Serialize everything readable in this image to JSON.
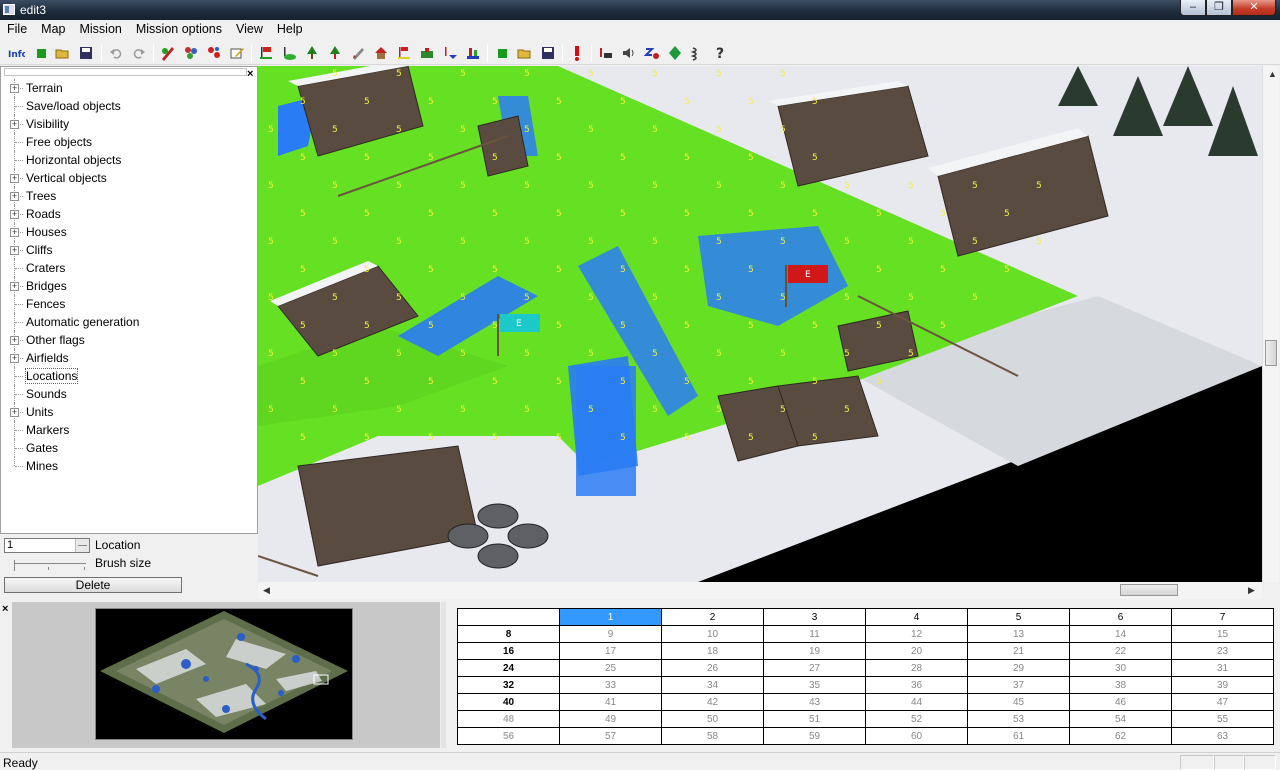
{
  "window": {
    "title": "edit3"
  },
  "menu": [
    "File",
    "Map",
    "Mission",
    "Mission options",
    "View",
    "Help"
  ],
  "toolbar": {
    "info_label": "Info",
    "icons": [
      "info-icon",
      "new-icon",
      "open-icon",
      "save-icon",
      "undo-icon",
      "redo-icon",
      "terrain-paint-icon",
      "objects-icon",
      "objects-red-icon",
      "edit-icon",
      "flag-place-icon",
      "flag-green-icon",
      "tree-icon",
      "tree-red-icon",
      "pencil-icon",
      "house-icon",
      "flag-yellow-icon",
      "unit-icon",
      "marker-icon",
      "airfield-icon",
      "green-square-icon",
      "open-icon",
      "save-icon",
      "alert-icon",
      "sound-icon",
      "speaker-icon",
      "mines-icon",
      "diamond-icon",
      "wave-icon",
      "help-icon"
    ]
  },
  "tree": {
    "items": [
      {
        "label": "Terrain",
        "expandable": true
      },
      {
        "label": "Save/load objects",
        "expandable": false
      },
      {
        "label": "Visibility",
        "expandable": true
      },
      {
        "label": "Free objects",
        "expandable": false
      },
      {
        "label": "Horizontal objects",
        "expandable": false
      },
      {
        "label": "Vertical objects",
        "expandable": true
      },
      {
        "label": "Trees",
        "expandable": true
      },
      {
        "label": "Roads",
        "expandable": true
      },
      {
        "label": "Houses",
        "expandable": true
      },
      {
        "label": "Cliffs",
        "expandable": true
      },
      {
        "label": "Craters",
        "expandable": false
      },
      {
        "label": "Bridges",
        "expandable": true
      },
      {
        "label": "Fences",
        "expandable": false
      },
      {
        "label": "Automatic generation",
        "expandable": false
      },
      {
        "label": "Other flags",
        "expandable": true
      },
      {
        "label": "Airfields",
        "expandable": true
      },
      {
        "label": "Locations",
        "expandable": false,
        "selected": true
      },
      {
        "label": "Sounds",
        "expandable": false
      },
      {
        "label": "Units",
        "expandable": true
      },
      {
        "label": "Markers",
        "expandable": false
      },
      {
        "label": "Gates",
        "expandable": false
      },
      {
        "label": "Mines",
        "expandable": false
      }
    ]
  },
  "location": {
    "value": "1",
    "label": "Location",
    "brush_label": "Brush size",
    "brush_size": 0,
    "delete_label": "Delete"
  },
  "map": {
    "zone_value": "5",
    "flags": [
      {
        "text": "E",
        "color": "#d01818"
      },
      {
        "text": "E",
        "color": "#1cc8c8"
      }
    ],
    "colors": {
      "grass": "#66e022",
      "water": "#2a7cf4",
      "snow": "#e8eaee"
    }
  },
  "grid": {
    "header": [
      "",
      "1",
      "2",
      "3",
      "4",
      "5",
      "6",
      "7"
    ],
    "rows": [
      [
        "8",
        "9",
        "10",
        "11",
        "12",
        "13",
        "14",
        "15"
      ],
      [
        "16",
        "17",
        "18",
        "19",
        "20",
        "21",
        "22",
        "23"
      ],
      [
        "24",
        "25",
        "26",
        "27",
        "28",
        "29",
        "30",
        "31"
      ],
      [
        "32",
        "33",
        "34",
        "35",
        "36",
        "37",
        "38",
        "39"
      ],
      [
        "40",
        "41",
        "42",
        "43",
        "44",
        "45",
        "46",
        "47"
      ],
      [
        "48",
        "49",
        "50",
        "51",
        "52",
        "53",
        "54",
        "55"
      ],
      [
        "56",
        "57",
        "58",
        "59",
        "60",
        "61",
        "62",
        "63"
      ]
    ],
    "selected": "1"
  },
  "status": {
    "text": "Ready"
  }
}
